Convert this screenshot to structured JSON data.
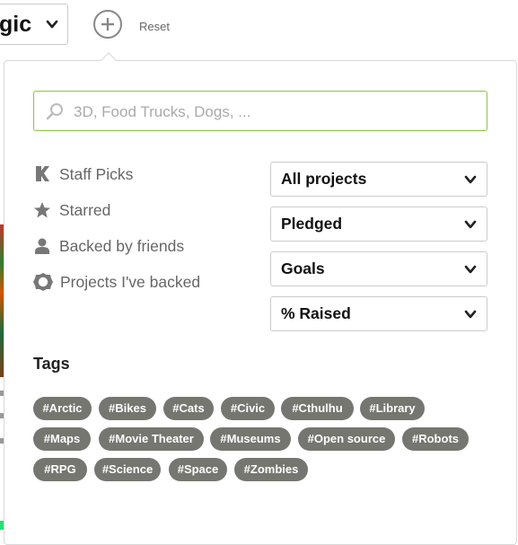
{
  "topbar": {
    "category_label": "gic",
    "reset_label": "Reset"
  },
  "search": {
    "value": "",
    "placeholder": "3D, Food Trucks, Dogs, ..."
  },
  "filters": [
    {
      "label": "Staff Picks",
      "icon": "kickstarter-k-icon"
    },
    {
      "label": "Starred",
      "icon": "star-icon"
    },
    {
      "label": "Backed by friends",
      "icon": "person-icon"
    },
    {
      "label": "Projects I've backed",
      "icon": "badge-icon"
    }
  ],
  "dropdowns": [
    {
      "label": "All projects"
    },
    {
      "label": "Pledged"
    },
    {
      "label": "Goals"
    },
    {
      "label": "% Raised"
    }
  ],
  "tags": {
    "title": "Tags",
    "items": [
      "#Arctic",
      "#Bikes",
      "#Cats",
      "#Civic",
      "#Cthulhu",
      "#Library",
      "#Maps",
      "#Movie Theater",
      "#Museums",
      "#Open source",
      "#Robots",
      "#RPG",
      "#Science",
      "#Space",
      "#Zombies"
    ]
  },
  "colors": {
    "accent_green": "#8cc63f",
    "tag_bg": "#767671"
  }
}
